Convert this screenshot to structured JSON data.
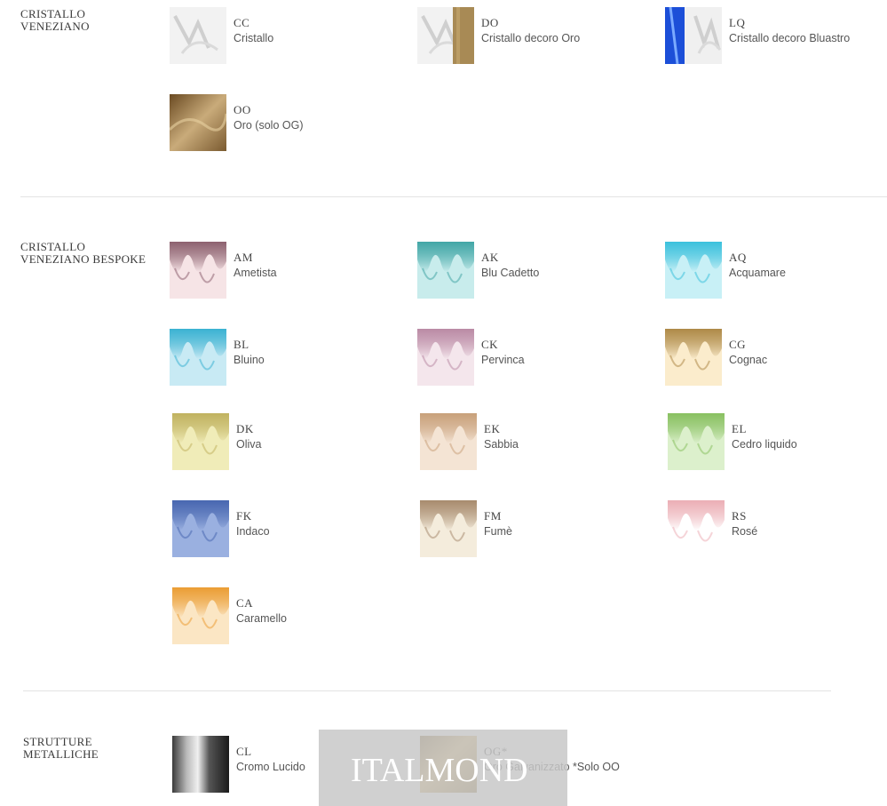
{
  "sections": [
    {
      "title_lines": [
        "CRISTALLO",
        "VENEZIANO"
      ],
      "items": [
        {
          "code": "CC",
          "name": "Cristallo",
          "swatch": "crystal"
        },
        {
          "code": "DO",
          "name": "Cristallo decoro Oro",
          "swatch": "crystal-gold"
        },
        {
          "code": "LQ",
          "name": "Cristallo decoro Bluastro",
          "swatch": "crystal-blue"
        },
        {
          "code": "OO",
          "name": "Oro (solo OG)",
          "swatch": "gold-leaf"
        }
      ]
    },
    {
      "title_lines": [
        "CRISTALLO",
        "VENEZIANO BESPOKE"
      ],
      "items": [
        {
          "code": "AM",
          "name": "Ametista",
          "swatch": "ametista"
        },
        {
          "code": "AK",
          "name": "Blu Cadetto",
          "swatch": "blu-cadetto"
        },
        {
          "code": "AQ",
          "name": "Acquamare",
          "swatch": "acquamare"
        },
        {
          "code": "BL",
          "name": "Bluino",
          "swatch": "bluino"
        },
        {
          "code": "CK",
          "name": "Pervinca",
          "swatch": "pervinca"
        },
        {
          "code": "CG",
          "name": "Cognac",
          "swatch": "cognac"
        },
        {
          "code": "DK",
          "name": "Oliva",
          "swatch": "oliva"
        },
        {
          "code": "EK",
          "name": "Sabbia",
          "swatch": "sabbia"
        },
        {
          "code": "EL",
          "name": "Cedro liquido",
          "swatch": "cedro"
        },
        {
          "code": "FK",
          "name": "Indaco",
          "swatch": "indaco"
        },
        {
          "code": "FM",
          "name": "Fumè",
          "swatch": "fume"
        },
        {
          "code": "RS",
          "name": "Rosé",
          "swatch": "rose"
        },
        {
          "code": "CA",
          "name": "Caramello",
          "swatch": "caramello"
        }
      ]
    },
    {
      "title_lines": [
        "STRUTTURE",
        "METALLICHE"
      ],
      "items": [
        {
          "code": "CL",
          "name": "Cromo Lucido",
          "swatch": "chrome"
        },
        {
          "code": "OG*",
          "name": "Oro Galvanizzato *Solo OO",
          "swatch": "gold"
        }
      ]
    }
  ],
  "watermark": "ITALMOND",
  "swatch_colors": {
    "crystal": [
      "#f4f4f4",
      "#d8d8d8"
    ],
    "crystal-gold": [
      "#eeeeee",
      "#a88a55"
    ],
    "crystal-blue": [
      "#1c4fd8",
      "#e8e8e8"
    ],
    "gold-leaf": [
      "#8a6a3a",
      "#c9ab7a"
    ],
    "ametista": [
      "#f6e4e6",
      "#7a4a5a"
    ],
    "blu-cadetto": [
      "#c8ecec",
      "#2a9a9a"
    ],
    "acquamare": [
      "#c8f0f6",
      "#22b8d8"
    ],
    "bluino": [
      "#c8eaf4",
      "#22a8cc"
    ],
    "pervinca": [
      "#f4e6ec",
      "#b07a98"
    ],
    "cognac": [
      "#fbeccc",
      "#a07830"
    ],
    "oliva": [
      "#f0ecb8",
      "#b8a850"
    ],
    "sabbia": [
      "#f4e4d4",
      "#c0946a"
    ],
    "cedro": [
      "#dcf0cc",
      "#7ab84e"
    ],
    "indaco": [
      "#9ab0e0",
      "#3a5aa8"
    ],
    "fume": [
      "#f4ecdc",
      "#9a7a5a"
    ],
    "rose": [
      "#ffffff",
      "#e8a0a8"
    ],
    "caramello": [
      "#fbe6c4",
      "#e8901a"
    ],
    "chrome": [
      "#d0d0d0",
      "#2a2a2a"
    ],
    "gold": [
      "#c8a050",
      "#7a5a20"
    ]
  }
}
